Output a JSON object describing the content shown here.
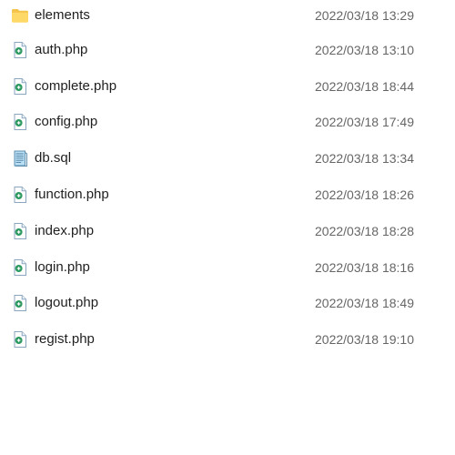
{
  "files": [
    {
      "name": "elements",
      "date": "2022/03/18 13:29",
      "icon": "folder-icon"
    },
    {
      "name": "auth.php",
      "date": "2022/03/18 13:10",
      "icon": "php-file-icon"
    },
    {
      "name": "complete.php",
      "date": "2022/03/18 18:44",
      "icon": "php-file-icon"
    },
    {
      "name": "config.php",
      "date": "2022/03/18 17:49",
      "icon": "php-file-icon"
    },
    {
      "name": "db.sql",
      "date": "2022/03/18 13:34",
      "icon": "sql-file-icon"
    },
    {
      "name": "function.php",
      "date": "2022/03/18 18:26",
      "icon": "php-file-icon"
    },
    {
      "name": "index.php",
      "date": "2022/03/18 18:28",
      "icon": "php-file-icon"
    },
    {
      "name": "login.php",
      "date": "2022/03/18 18:16",
      "icon": "php-file-icon"
    },
    {
      "name": "logout.php",
      "date": "2022/03/18 18:49",
      "icon": "php-file-icon"
    },
    {
      "name": "regist.php",
      "date": "2022/03/18 19:10",
      "icon": "php-file-icon"
    }
  ],
  "colors": {
    "folder": "#f3c34a",
    "php_badge": "#2e9a62",
    "page": "#ffffff",
    "text": "#1f1f1f",
    "date_text": "#666666"
  }
}
